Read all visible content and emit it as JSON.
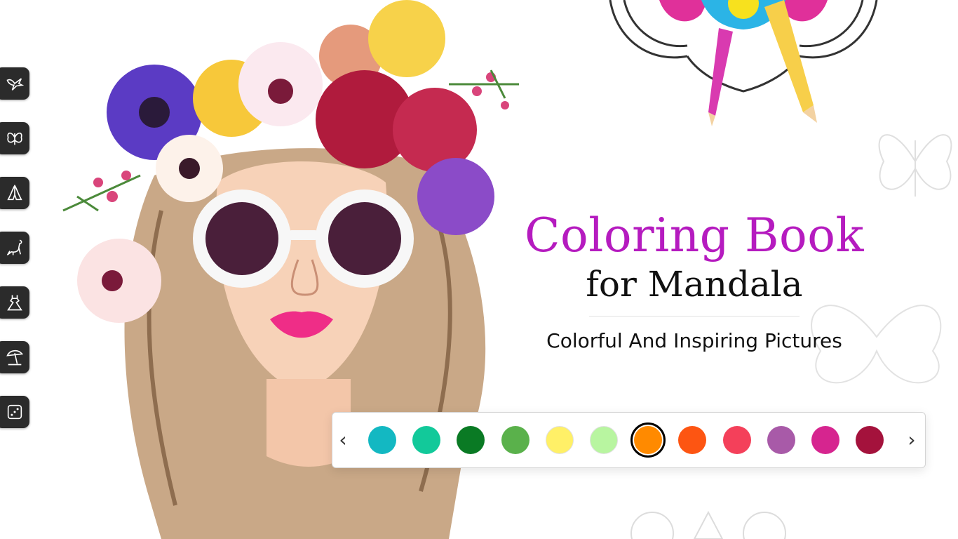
{
  "title": {
    "line1": "Coloring Book",
    "line2": "for Mandala",
    "subtitle": "Colorful And Inspiring Pictures"
  },
  "sidebar": {
    "items": [
      {
        "icon": "bird-icon"
      },
      {
        "icon": "butterfly-icon"
      },
      {
        "icon": "praying-hands-icon"
      },
      {
        "icon": "dinosaur-icon"
      },
      {
        "icon": "dress-icon"
      },
      {
        "icon": "beach-umbrella-icon"
      },
      {
        "icon": "dice-icon"
      }
    ]
  },
  "palette": {
    "prev_label": "‹",
    "next_label": "›",
    "colors": [
      "#13b8c2",
      "#12c99a",
      "#0a7a24",
      "#5ab14b",
      "#fff067",
      "#b8f5a0",
      "#ff8a00",
      "#fd5512",
      "#f4405a",
      "#a85aa8",
      "#d6258f",
      "#a4123c"
    ],
    "selected_index": 6
  },
  "theme": {
    "title_color": "#b51bbf",
    "text_color": "#111111",
    "sidebar_bg": "#2b2b2b"
  }
}
